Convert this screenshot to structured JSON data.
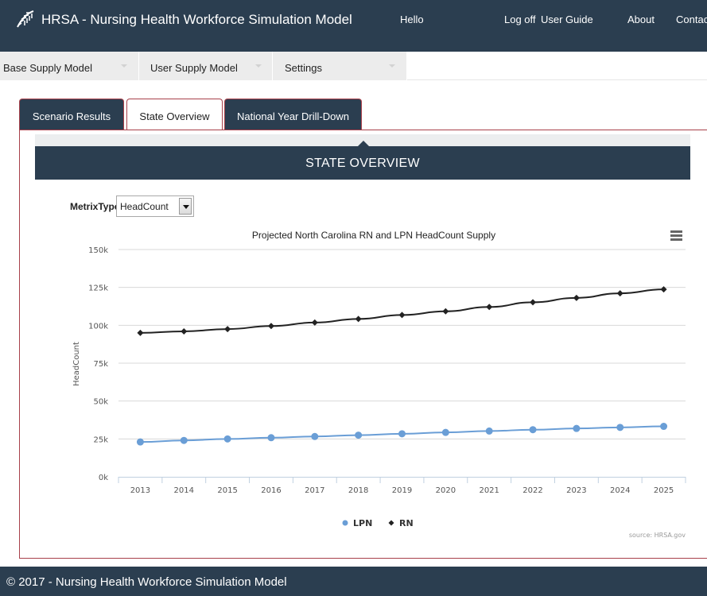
{
  "header": {
    "title": "HRSA - Nursing Health Workforce Simulation Model",
    "greeting": "Hello",
    "links": {
      "logoff": "Log off",
      "user_guide": "User Guide",
      "about": "About",
      "contact": "Contact"
    }
  },
  "menu": {
    "items": [
      {
        "label": "Base Supply Model"
      },
      {
        "label": "User Supply Model"
      },
      {
        "label": "Settings"
      }
    ]
  },
  "tabs": [
    {
      "label": "Scenario Results",
      "active": false
    },
    {
      "label": "State Overview",
      "active": true
    },
    {
      "label": "National Year Drill-Down",
      "active": false
    }
  ],
  "overview": {
    "header": "STATE OVERVIEW",
    "metrix_label": "MetrixType",
    "metrix_value": "HeadCount"
  },
  "colors": {
    "navbar": "#2b3e50",
    "tab_border": "#a8404a",
    "lpn_series": "#6a9ed6",
    "rn_series": "#222222"
  },
  "chart_data": {
    "type": "line",
    "title": "Projected North Carolina RN and LPN HeadCount Supply",
    "ylabel": "HeadCount",
    "xlabel": "",
    "ylim": [
      0,
      150000
    ],
    "y_ticks": [
      "0k",
      "25k",
      "50k",
      "75k",
      "100k",
      "125k",
      "150k"
    ],
    "categories": [
      "2013",
      "2014",
      "2015",
      "2016",
      "2017",
      "2018",
      "2019",
      "2020",
      "2021",
      "2022",
      "2023",
      "2024",
      "2025"
    ],
    "series": [
      {
        "name": "LPN",
        "marker": "circle",
        "values": [
          23000,
          24000,
          25000,
          25800,
          26600,
          27500,
          28400,
          29300,
          30200,
          31100,
          31900,
          32600,
          33300
        ]
      },
      {
        "name": "RN",
        "marker": "diamond",
        "values": [
          95000,
          96000,
          97500,
          99500,
          101800,
          104200,
          106800,
          109200,
          112100,
          115200,
          118100,
          121100,
          123700
        ]
      }
    ],
    "legend_position": "bottom-center",
    "grid": true,
    "credits": "source: HRSA.gov"
  },
  "footer": {
    "text": "© 2017 - Nursing Health Workforce Simulation Model"
  }
}
